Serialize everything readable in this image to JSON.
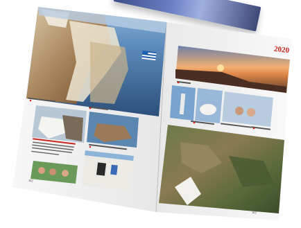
{
  "book": {
    "year_label": "2020",
    "left_page_number": "162",
    "right_page_number": "163"
  }
}
